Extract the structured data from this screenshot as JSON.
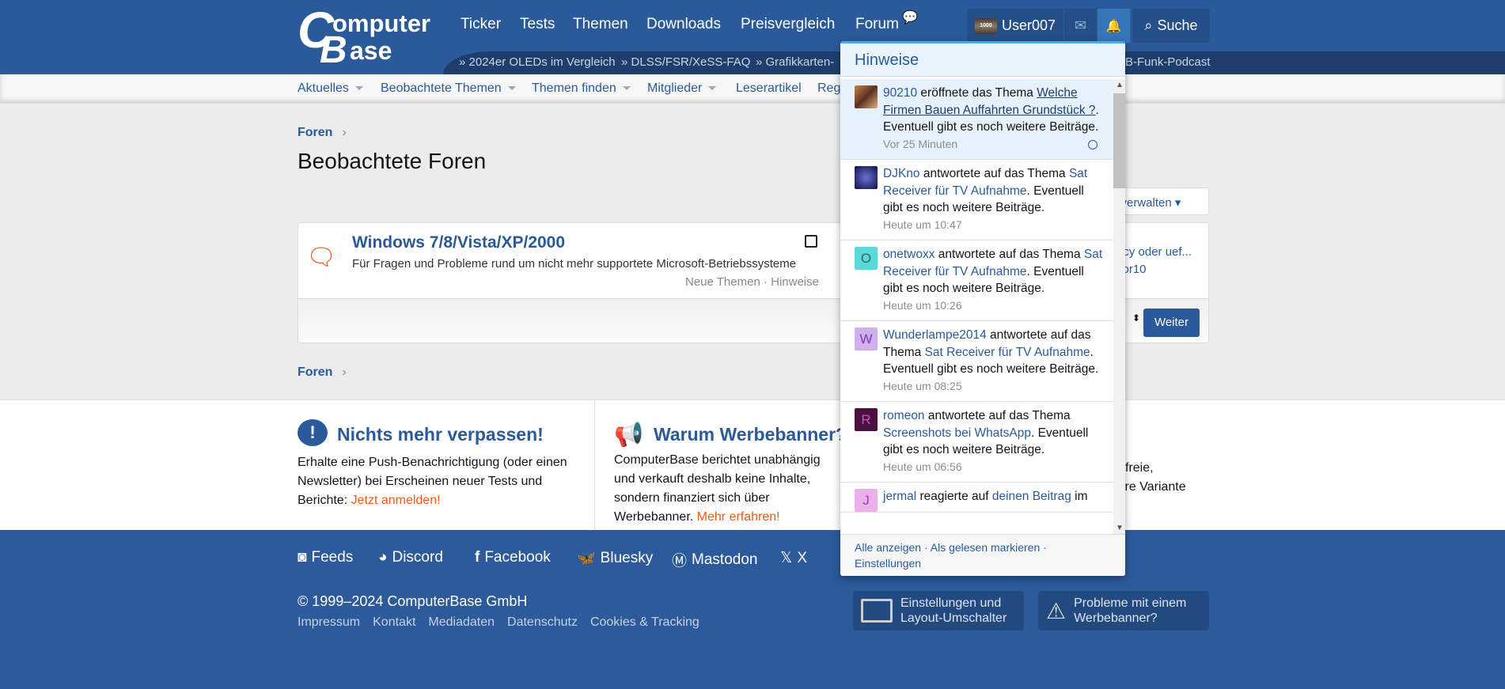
{
  "header": {
    "logo_text": "ComputerBase",
    "nav": [
      "Ticker",
      "Tests",
      "Themen",
      "Downloads",
      "Preisvergleich",
      "Forum"
    ],
    "username": "User007",
    "avatar_text": "1000",
    "search_label": "Suche",
    "ticker": [
      "2024er OLEDs im Vergleich",
      "DLSS/FSR/XeSS-FAQ",
      "Grafikkarten-",
      "B-Funk-Podcast"
    ]
  },
  "subnav": [
    "Aktuelles",
    "Beobachtete Themen",
    "Themen finden",
    "Mitglieder",
    "Leserartikel",
    "Regi"
  ],
  "breadcrumb": "Foren",
  "page_title": "Beobachtete Foren",
  "forum": {
    "title": "Windows 7/8/Vista/XP/2000",
    "description": "Für Fragen und Probleme rund um nicht mehr supportete Microsoft-Betriebssysteme",
    "meta": "Neue Themen · Hinweise"
  },
  "right": {
    "manage_label": "n verwalten",
    "latest_title": "acy oder uef...",
    "latest_user": "vor10",
    "next_label": "Weiter"
  },
  "notifications": {
    "title": "Hinweise",
    "items": [
      {
        "user": "90210",
        "action": " eröffnete das Thema ",
        "thread": "Welche Firmen Bauen Auffahrten Grundstück ?",
        "suffix": ". Eventuell gibt es noch weitere Beiträge.",
        "time": "Vor 25 Minuten",
        "unread": true
      },
      {
        "user": "DJKno",
        "action": " antwortete auf das Thema ",
        "thread": "Sat Receiver für TV Aufnahme",
        "suffix": ". Eventuell gibt es noch weitere Beiträge.",
        "time": "Heute um 10:47"
      },
      {
        "user": "onetwoxx",
        "initial": "O",
        "action": " antwortete auf das Thema ",
        "thread": "Sat Receiver für TV Aufnahme",
        "suffix": ". Eventuell gibt es noch weitere Beiträge.",
        "time": "Heute um 10:26",
        "color": "#5cd8d8",
        "fg": "#2a6a6a"
      },
      {
        "user": "Wunderlampe2014",
        "initial": "W",
        "action": " antwortete auf das Thema ",
        "thread": "Sat Receiver für TV Aufnahme",
        "suffix": ". Eventuell gibt es noch weitere Beiträge.",
        "time": "Heute um 08:25",
        "color": "#d0b0ec",
        "fg": "#7a3ab8"
      },
      {
        "user": "romeon",
        "initial": "R",
        "action": " antwortete auf das Thema ",
        "thread": "Screenshots bei WhatsApp",
        "suffix": ". Eventuell gibt es noch weitere Beiträge.",
        "time": "Heute um 06:56",
        "color": "#4a1040",
        "fg": "#d050c0"
      },
      {
        "user": "jermal",
        "initial": "J",
        "action": " reagierte auf ",
        "thread": "deinen Beitrag",
        "suffix": " im",
        "time": "",
        "color": "#eab0ea",
        "fg": "#a040a0"
      }
    ],
    "footer": {
      "show_all": "Alle anzeigen",
      "mark_read": "Als gelesen markieren",
      "settings": "Einstellungen"
    }
  },
  "promo": {
    "left_title": "Nichts mehr verpassen!",
    "left_text": "Erhalte eine Push-Benachrichtigung (oder einen Newsletter) bei Erscheinen neuer Tests und Berichte: ",
    "left_link": "Jetzt anmelden!",
    "mid_title": "Warum Werbebanner?",
    "mid_text": "ComputerBase berichtet unabhängig und verkauft deshalb keine Inhalte, sondern finanziert sich über Werbebanner. ",
    "mid_link": "Mehr erfahren!",
    "right_text_1": "freie,",
    "right_text_2": "ire Variante"
  },
  "footer": {
    "social": [
      "Feeds",
      "Discord",
      "Facebook",
      "Bluesky",
      "Mastodon",
      "X"
    ],
    "copyright": "© 1999–2024 ComputerBase GmbH",
    "links": [
      "Impressum",
      "Kontakt",
      "Mediadaten",
      "Datenschutz",
      "Cookies & Tracking"
    ],
    "settings_btn": "Einstellungen und Layout-Umschalter",
    "ads_btn": "Probleme mit einem Werbebanner?"
  },
  "colors": {
    "brand": "#2b5a9a",
    "accent": "#f05a14"
  }
}
